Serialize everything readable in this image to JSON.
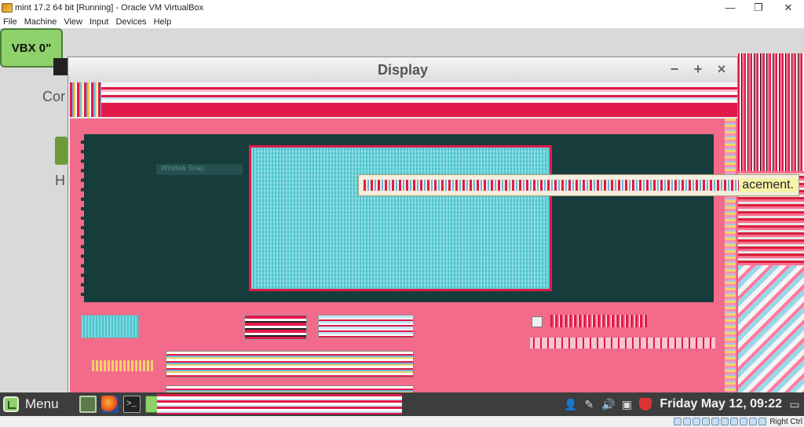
{
  "host": {
    "window_title": "mint 17.2 64 bit [Running] - Oracle VM VirtualBox",
    "controls": {
      "minimize": "—",
      "restore": "❐",
      "close": "✕"
    },
    "menu": [
      "File",
      "Machine",
      "View",
      "Input",
      "Devices",
      "Help"
    ]
  },
  "desktop": {
    "vbx_label": "VBX 0\"",
    "icon1_label": "Cor",
    "icon2_label": "H"
  },
  "dialog": {
    "title": "Display",
    "controls": {
      "minimize": "−",
      "maximize": "+",
      "close": "×"
    },
    "window_snap_label": "Window Snap",
    "tooltip_tail": "acement."
  },
  "taskbar": {
    "menu_label": "Menu",
    "terminal_glyph": ">_",
    "clock": "Friday May 12, 09:22",
    "tray_icons": [
      "user-icon",
      "pen-icon",
      "volume-icon",
      "clipboard-icon",
      "shield-icon",
      "window-icon"
    ]
  },
  "statusbar": {
    "right_ctrl": "Right Ctrl"
  }
}
